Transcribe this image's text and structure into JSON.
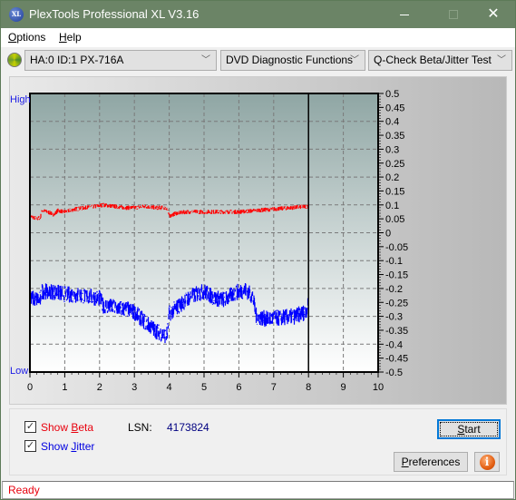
{
  "window": {
    "title": "PlexTools Professional XL V3.16",
    "app_icon_text": "XL",
    "controls": {
      "minimize": "—",
      "maximize": "□",
      "close": "✕"
    }
  },
  "menu": {
    "items": [
      {
        "label": "Options",
        "accel": "O",
        "rest": "ptions"
      },
      {
        "label": "Help",
        "accel": "H",
        "rest": "elp"
      }
    ]
  },
  "toolbar": {
    "drive_select": "HA:0 ID:1  PX-716A",
    "function_select": "DVD Diagnostic Functions",
    "test_select": "Q-Check Beta/Jitter Test",
    "chevron": "﹀"
  },
  "chart_data": {
    "type": "line",
    "title": "",
    "y_label_top": "High",
    "y_label_bottom": "Low",
    "xlim": [
      0,
      10
    ],
    "ylim": [
      -0.5,
      0.5
    ],
    "x_ticks": [
      "0",
      "1",
      "2",
      "3",
      "4",
      "5",
      "6",
      "7",
      "8",
      "9",
      "10"
    ],
    "y_ticks": [
      "0.5",
      "0.45",
      "0.4",
      "0.35",
      "0.3",
      "0.25",
      "0.2",
      "0.15",
      "0.1",
      "0.05",
      "0",
      "-0.05",
      "-0.1",
      "-0.15",
      "-0.2",
      "-0.25",
      "-0.3",
      "-0.35",
      "-0.4",
      "-0.45",
      "-0.5"
    ],
    "grid": true,
    "position_marker_x": 8.0,
    "series": [
      {
        "name": "Beta",
        "color": "#ff0000",
        "x": [
          0,
          0.2,
          0.3,
          0.35,
          0.5,
          0.7,
          0.8,
          1.0,
          1.3,
          1.6,
          1.9,
          2.1,
          2.4,
          2.7,
          3.0,
          3.3,
          3.6,
          3.9,
          3.95,
          4.0,
          4.2,
          4.5,
          5.0,
          5.5,
          6.0,
          6.5,
          7.0,
          7.5,
          8.0
        ],
        "y": [
          0.06,
          0.05,
          0.055,
          0.08,
          0.075,
          0.065,
          0.08,
          0.075,
          0.085,
          0.09,
          0.095,
          0.1,
          0.095,
          0.09,
          0.09,
          0.095,
          0.09,
          0.09,
          0.085,
          0.06,
          0.07,
          0.075,
          0.075,
          0.075,
          0.075,
          0.08,
          0.085,
          0.09,
          0.095
        ],
        "noise": 0.008
      },
      {
        "name": "Jitter",
        "color": "#0000ff",
        "x": [
          0,
          0.3,
          0.35,
          0.6,
          1.0,
          1.5,
          2.0,
          2.1,
          2.5,
          2.8,
          3.0,
          3.3,
          3.6,
          3.9,
          3.95,
          4.0,
          4.3,
          4.6,
          4.9,
          5.0,
          5.3,
          5.6,
          5.9,
          6.2,
          6.4,
          6.5,
          6.8,
          7.2,
          7.6,
          7.9,
          8.0
        ],
        "y": [
          -0.235,
          -0.24,
          -0.21,
          -0.21,
          -0.22,
          -0.225,
          -0.235,
          -0.26,
          -0.27,
          -0.275,
          -0.285,
          -0.32,
          -0.35,
          -0.37,
          -0.36,
          -0.29,
          -0.26,
          -0.23,
          -0.215,
          -0.21,
          -0.235,
          -0.24,
          -0.215,
          -0.205,
          -0.23,
          -0.3,
          -0.31,
          -0.305,
          -0.3,
          -0.285,
          -0.26
        ],
        "noise": 0.03
      }
    ]
  },
  "controls": {
    "show_beta": {
      "label_pre": "Show ",
      "accel": "B",
      "label_post": "eta",
      "checked": true,
      "mark": "✓",
      "color": "#e8000d"
    },
    "show_jitter": {
      "label_pre": "Show ",
      "accel": "J",
      "label_post": "itter",
      "checked": true,
      "mark": "✓",
      "color": "#0000e0"
    },
    "lsn_label": "LSN:",
    "lsn_value": "4173824",
    "start_button": {
      "accel": "S",
      "rest": "tart"
    },
    "preferences_button": {
      "accel": "P",
      "rest": "references"
    },
    "info_button_glyph": "i"
  },
  "status": {
    "text": "Ready"
  }
}
